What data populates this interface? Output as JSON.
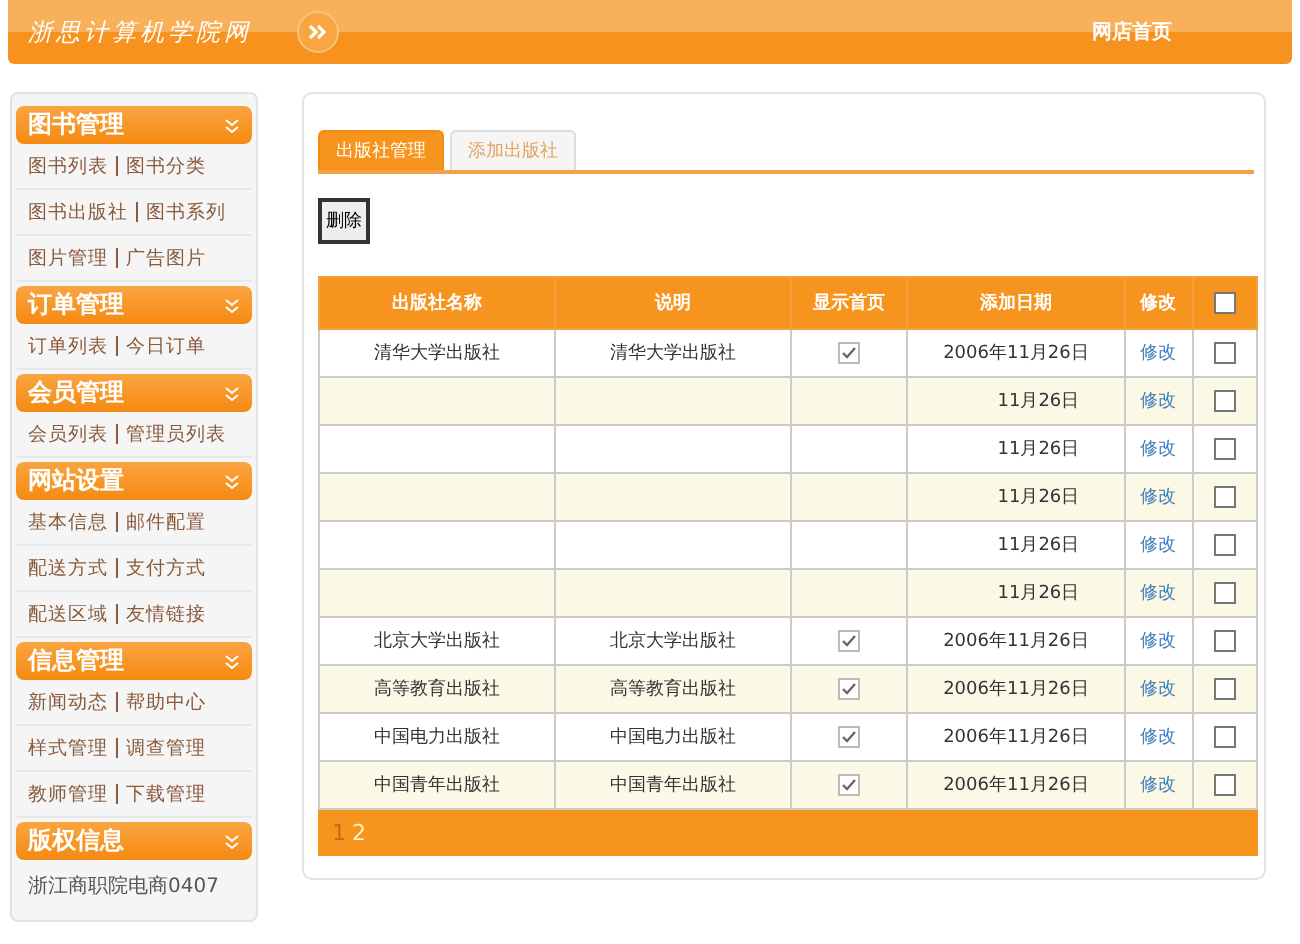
{
  "header": {
    "logo": "浙思计算机学院网",
    "nav": "网店首页"
  },
  "sidebar": [
    {
      "title": "图书管理",
      "links": [
        [
          "图书列表",
          "图书分类"
        ],
        [
          "图书出版社",
          "图书系列"
        ],
        [
          "图片管理",
          "广告图片"
        ]
      ]
    },
    {
      "title": "订单管理",
      "links": [
        [
          "订单列表",
          "今日订单"
        ]
      ]
    },
    {
      "title": "会员管理",
      "links": [
        [
          "会员列表",
          "管理员列表"
        ]
      ]
    },
    {
      "title": "网站设置",
      "links": [
        [
          "基本信息",
          "邮件配置"
        ],
        [
          "配送方式",
          "支付方式"
        ],
        [
          "配送区域",
          "友情链接"
        ]
      ]
    },
    {
      "title": "信息管理",
      "links": [
        [
          "新闻动态",
          "帮助中心"
        ],
        [
          "样式管理",
          "调查管理"
        ],
        [
          "教师管理",
          "下载管理"
        ]
      ]
    },
    {
      "title": "版权信息",
      "note": "浙江商职院电商0407"
    }
  ],
  "tabs": [
    {
      "label": "出版社管理",
      "selected": true
    },
    {
      "label": "添加出版社",
      "selected": false
    }
  ],
  "delete_button": "删除",
  "table": {
    "columns": [
      "出版社名称",
      "说明",
      "显示首页",
      "添加日期",
      "修改"
    ],
    "select_all": false,
    "rows": [
      {
        "name": "清华大学出版社",
        "desc": "清华大学出版社",
        "home": true,
        "date": "2006年11月26日",
        "edit": "修改",
        "checked": false
      },
      {
        "date": "11月26日",
        "edit": "修改",
        "checked": false
      },
      {
        "date": "11月26日",
        "edit": "修改",
        "checked": false
      },
      {
        "date": "11月26日",
        "edit": "修改",
        "checked": false
      },
      {
        "date": "11月26日",
        "edit": "修改",
        "checked": false
      },
      {
        "date": "11月26日",
        "edit": "修改",
        "checked": false
      },
      {
        "name": "北京大学出版社",
        "desc": "北京大学出版社",
        "home": true,
        "date": "2006年11月26日",
        "edit": "修改",
        "checked": false
      },
      {
        "name": "高等教育出版社",
        "desc": "高等教育出版社",
        "home": true,
        "date": "2006年11月26日",
        "edit": "修改",
        "checked": false
      },
      {
        "name": "中国电力出版社",
        "desc": "中国电力出版社",
        "home": true,
        "date": "2006年11月26日",
        "edit": "修改",
        "checked": false
      },
      {
        "name": "中国青年出版社",
        "desc": "中国青年出版社",
        "home": true,
        "date": "2006年11月26日",
        "edit": "修改",
        "checked": false
      }
    ]
  },
  "pages": [
    {
      "label": "1",
      "selected": true
    },
    {
      "label": "2",
      "selected": false
    }
  ]
}
